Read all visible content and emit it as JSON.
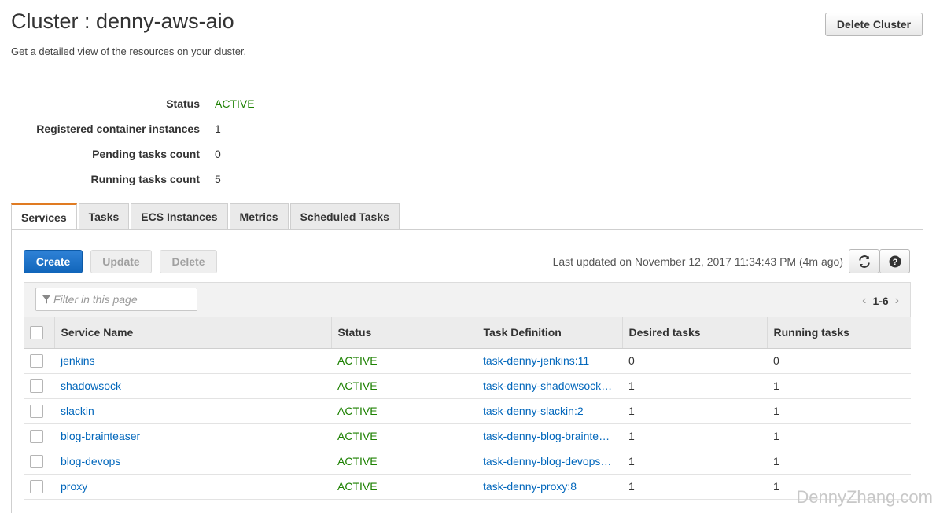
{
  "header": {
    "title": "Cluster : denny-aws-aio",
    "subtitle": "Get a detailed view of the resources on your cluster.",
    "delete_cluster_label": "Delete Cluster"
  },
  "summary": [
    {
      "label": "Status",
      "value": "ACTIVE"
    },
    {
      "label": "Registered container instances",
      "value": "1"
    },
    {
      "label": "Pending tasks count",
      "value": "0"
    },
    {
      "label": "Running tasks count",
      "value": "5"
    }
  ],
  "tabs": [
    {
      "label": "Services",
      "active": true
    },
    {
      "label": "Tasks"
    },
    {
      "label": "ECS Instances"
    },
    {
      "label": "Metrics"
    },
    {
      "label": "Scheduled Tasks"
    }
  ],
  "toolbar": {
    "create_label": "Create",
    "update_label": "Update",
    "delete_label": "Delete",
    "last_updated": "Last updated on November 12, 2017 11:34:43 PM (4m ago)",
    "refresh_icon": "refresh-icon",
    "help_icon": "help-icon"
  },
  "filter": {
    "placeholder": "Filter in this page",
    "pagination": "1-6"
  },
  "table": {
    "columns": [
      "Service Name",
      "Status",
      "Task Definition",
      "Desired tasks",
      "Running tasks"
    ],
    "rows": [
      {
        "service": "jenkins",
        "status": "ACTIVE",
        "task_def": "task-denny-jenkins:11",
        "desired": "0",
        "running": "0"
      },
      {
        "service": "shadowsock",
        "status": "ACTIVE",
        "task_def": "task-denny-shadowsock…",
        "desired": "1",
        "running": "1"
      },
      {
        "service": "slackin",
        "status": "ACTIVE",
        "task_def": "task-denny-slackin:2",
        "desired": "1",
        "running": "1"
      },
      {
        "service": "blog-brainteaser",
        "status": "ACTIVE",
        "task_def": "task-denny-blog-brainte…",
        "desired": "1",
        "running": "1"
      },
      {
        "service": "blog-devops",
        "status": "ACTIVE",
        "task_def": "task-denny-blog-devops…",
        "desired": "1",
        "running": "1"
      },
      {
        "service": "proxy",
        "status": "ACTIVE",
        "task_def": "task-denny-proxy:8",
        "desired": "1",
        "running": "1"
      }
    ]
  },
  "watermark": "DennyZhang.com",
  "colors": {
    "active_green": "#1d8102",
    "link_blue": "#0066bb",
    "primary_blue": "#1166bb",
    "tab_accent": "#e07b22"
  }
}
